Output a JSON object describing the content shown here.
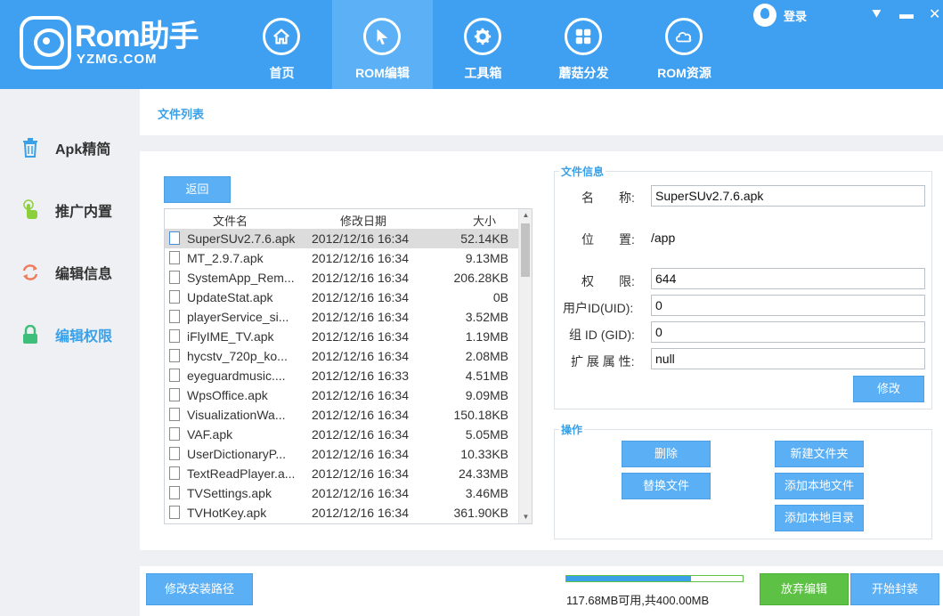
{
  "app": {
    "logo_main": "Rom助手",
    "logo_sub": "YZMG.COM",
    "login": "登录",
    "minimize": "▬",
    "dropdown": "⯆",
    "close": "✕"
  },
  "nav": [
    {
      "label": "首页",
      "icon": "home-icon"
    },
    {
      "label": "ROM编辑",
      "icon": "cursor-icon",
      "active": true
    },
    {
      "label": "工具箱",
      "icon": "gear-icon"
    },
    {
      "label": "蘑菇分发",
      "icon": "grid-icon"
    },
    {
      "label": "ROM资源",
      "icon": "cloud-icon"
    }
  ],
  "sidebar": [
    {
      "label": "Apk精简",
      "icon": "trash-icon"
    },
    {
      "label": "推广内置",
      "icon": "touch-icon"
    },
    {
      "label": "编辑信息",
      "icon": "refresh-icon"
    },
    {
      "label": "编辑权限",
      "icon": "lock-icon",
      "active": true
    }
  ],
  "tab_title": "文件列表",
  "back_button": "返回",
  "file_list": {
    "columns": [
      "文件名",
      "修改日期",
      "大小"
    ],
    "rows": [
      {
        "name": "SuperSUv2.7.6.apk",
        "date": "2012/12/16  16:34",
        "size": "52.14KB",
        "selected": true
      },
      {
        "name": "MT_2.9.7.apk",
        "date": "2012/12/16  16:34",
        "size": "9.13MB"
      },
      {
        "name": "SystemApp_Rem...",
        "date": "2012/12/16  16:34",
        "size": "206.28KB"
      },
      {
        "name": "UpdateStat.apk",
        "date": "2012/12/16  16:34",
        "size": "0B"
      },
      {
        "name": "playerService_si...",
        "date": "2012/12/16  16:34",
        "size": "3.52MB"
      },
      {
        "name": "iFlyIME_TV.apk",
        "date": "2012/12/16  16:34",
        "size": "1.19MB"
      },
      {
        "name": "hycstv_720p_ko...",
        "date": "2012/12/16  16:34",
        "size": "2.08MB"
      },
      {
        "name": "eyeguardmusic....",
        "date": "2012/12/16  16:33",
        "size": "4.51MB"
      },
      {
        "name": "WpsOffice.apk",
        "date": "2012/12/16  16:34",
        "size": "9.09MB"
      },
      {
        "name": "VisualizationWa...",
        "date": "2012/12/16  16:34",
        "size": "150.18KB"
      },
      {
        "name": "VAF.apk",
        "date": "2012/12/16  16:34",
        "size": "5.05MB"
      },
      {
        "name": "UserDictionaryP...",
        "date": "2012/12/16  16:34",
        "size": "10.33KB"
      },
      {
        "name": "TextReadPlayer.a...",
        "date": "2012/12/16  16:34",
        "size": "24.33MB"
      },
      {
        "name": "TVSettings.apk",
        "date": "2012/12/16  16:34",
        "size": "3.46MB"
      },
      {
        "name": "TVHotKey.apk",
        "date": "2012/12/16  16:34",
        "size": "361.90KB"
      }
    ]
  },
  "file_info": {
    "title": "文件信息",
    "name_label": "名　　称:",
    "name_value": "SuperSUv2.7.6.apk",
    "location_label": "位　　置:",
    "location_value": "/app",
    "perm_label": "权　　限:",
    "perm_value": "644",
    "uid_label": "用户ID(UID):",
    "uid_value": "0",
    "gid_label": "组 ID (GID):",
    "gid_value": "0",
    "ext_label": "扩 展 属 性:",
    "ext_value": "null",
    "modify_button": "修改"
  },
  "operations": {
    "title": "操作",
    "delete": "删除",
    "replace": "替换文件",
    "new_folder": "新建文件夹",
    "add_local_file": "添加本地文件",
    "add_local_dir": "添加本地目录"
  },
  "footer": {
    "install_path_button": "修改安装路径",
    "storage_text": "117.68MB可用,共400.00MB",
    "storage_used_fraction": 0.706,
    "discard_button": "放弃编辑",
    "package_button": "开始封装"
  }
}
